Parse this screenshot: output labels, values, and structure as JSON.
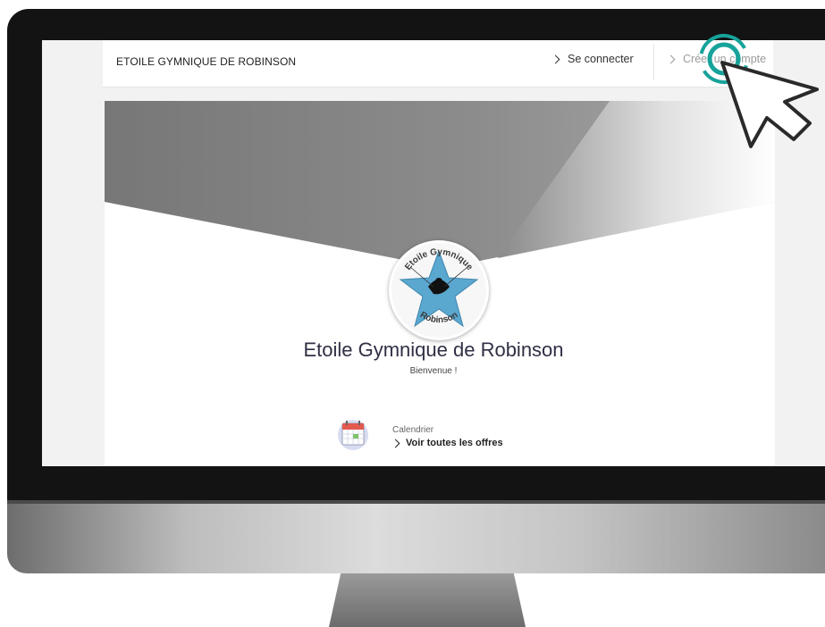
{
  "header": {
    "site_title": "ETOILE GYMNIQUE DE ROBINSON",
    "login_label": "Se connecter",
    "signup_label": "Créer un compte"
  },
  "club": {
    "name": "Etoile Gymnique de Robinson",
    "welcome": "Bienvenue !",
    "logo_text_top": "Etoile Gymnique",
    "logo_text_bottom": "Robinson"
  },
  "offers": {
    "category": "Calendrier",
    "link_label": "Voir toutes les offres"
  },
  "colors": {
    "logo_star": "#5aa7d0",
    "click_ring": "#17a39a",
    "title": "#2f2f45"
  }
}
